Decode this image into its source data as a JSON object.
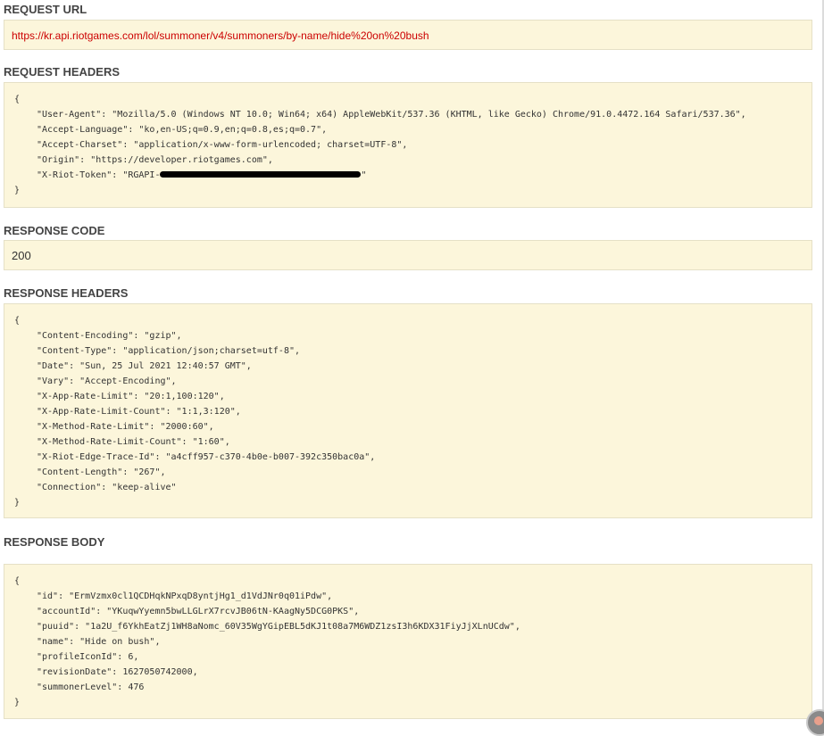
{
  "request_url": {
    "title": "REQUEST URL",
    "value": "https://kr.api.riotgames.com/lol/summoner/v4/summoners/by-name/hide%20on%20bush"
  },
  "request_headers": {
    "title": "REQUEST HEADERS",
    "open": "{",
    "close": "}",
    "lines": [
      "\"User-Agent\": \"Mozilla/5.0 (Windows NT 10.0; Win64; x64) AppleWebKit/537.36 (KHTML, like Gecko) Chrome/91.0.4472.164 Safari/537.36\",",
      "\"Accept-Language\": \"ko,en-US;q=0.9,en;q=0.8,es;q=0.7\",",
      "\"Accept-Charset\": \"application/x-www-form-urlencoded; charset=UTF-8\",",
      "\"Origin\": \"https://developer.riotgames.com\","
    ],
    "token_prefix": "\"X-Riot-Token\": \"RGAPI-",
    "token_suffix": "\""
  },
  "response_code": {
    "title": "RESPONSE CODE",
    "value": "200"
  },
  "response_headers": {
    "title": "RESPONSE HEADERS",
    "open": "{",
    "close": "}",
    "lines": [
      "\"Content-Encoding\": \"gzip\",",
      "\"Content-Type\": \"application/json;charset=utf-8\",",
      "\"Date\": \"Sun, 25 Jul 2021 12:40:57 GMT\",",
      "\"Vary\": \"Accept-Encoding\",",
      "\"X-App-Rate-Limit\": \"20:1,100:120\",",
      "\"X-App-Rate-Limit-Count\": \"1:1,3:120\",",
      "\"X-Method-Rate-Limit\": \"2000:60\",",
      "\"X-Method-Rate-Limit-Count\": \"1:60\",",
      "\"X-Riot-Edge-Trace-Id\": \"a4cff957-c370-4b0e-b007-392c350bac0a\",",
      "\"Content-Length\": \"267\",",
      "\"Connection\": \"keep-alive\""
    ]
  },
  "response_body": {
    "title": "RESPONSE BODY",
    "open": "{",
    "close": "}",
    "lines": [
      "\"id\": \"ErmVzmx0cl1QCDHqkNPxqD8yntjHg1_d1VdJNr0q01iPdw\",",
      "\"accountId\": \"YKuqwYyemn5bwLLGLrX7rcvJB06tN-KAagNy5DCG0PKS\",",
      "\"puuid\": \"1a2U_f6YkhEatZj1WH8aNomc_60V35WgYGipEBL5dKJ1t08a7M6WDZ1zsI3h6KDX31FiyJjXLnUCdw\",",
      "\"name\": \"Hide on bush\",",
      "\"profileIconId\": 6,",
      "\"revisionDate\": 1627050742000,",
      "\"summonerLevel\": 476"
    ]
  }
}
